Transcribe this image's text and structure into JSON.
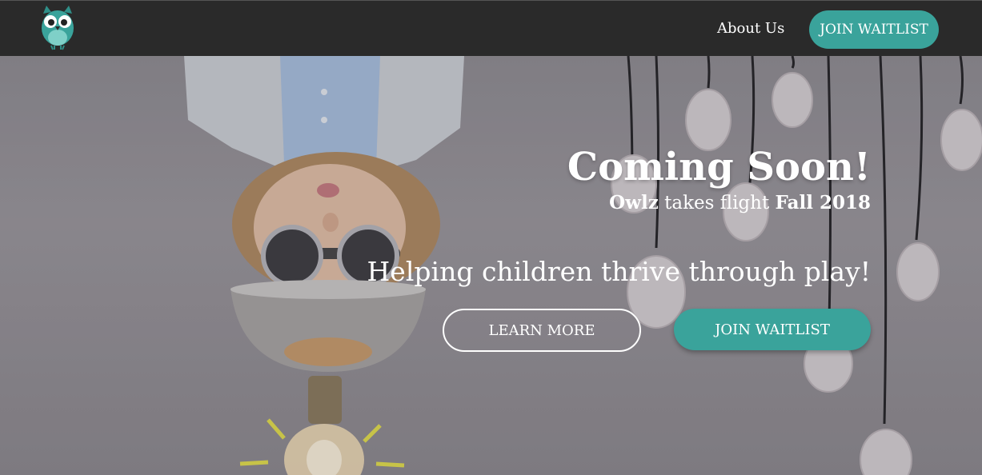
{
  "brand": {
    "logo_icon": "owl-logo-icon",
    "accent": "#3aa39b"
  },
  "nav": {
    "about_label": "About Us",
    "cta_label": "JOIN WAITLIST"
  },
  "hero": {
    "headline": "Coming Soon!",
    "subline": {
      "brand": "Owlz",
      "middle": " takes flight ",
      "season": "Fall 2018"
    },
    "tagline": "Helping children thrive through play!",
    "learn_more_label": "LEARN MORE",
    "join_label": "JOIN WAITLIST",
    "background_icon": "child-with-goggles-and-lightbulbs-photo"
  }
}
